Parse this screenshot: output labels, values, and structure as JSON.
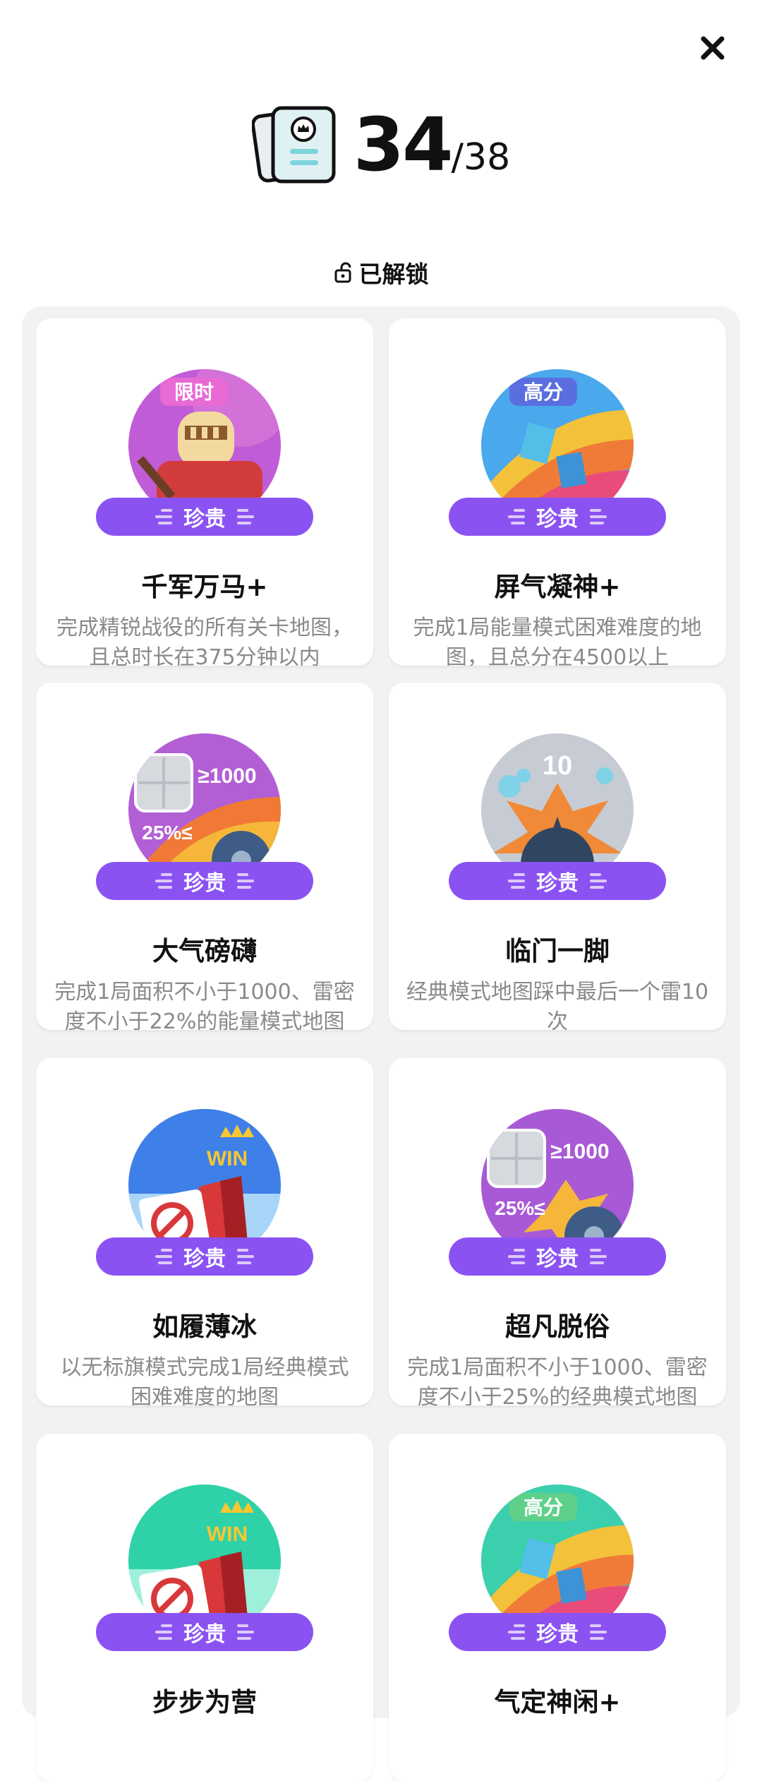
{
  "header": {
    "count": "34",
    "total": "/38"
  },
  "section": {
    "label": "已解锁"
  },
  "achievements": [
    {
      "badge_tag": "限时",
      "badge_icon": "knight-helmet-icon",
      "rarity": "珍贵",
      "title": "千军万马+",
      "desc": "完成精锐战役的所有关卡地图，且总时长在375分钟以内"
    },
    {
      "badge_tag": "高分",
      "badge_icon": "rainbow-road-icon",
      "rarity": "珍贵",
      "title": "屏气凝神+",
      "desc": "完成1局能量模式困难难度的地图，且总分在4500以上"
    },
    {
      "badge_tag": "≥1000",
      "badge_tag2": "25%≤",
      "badge_icon": "tile-mine-icon",
      "rarity": "珍贵",
      "title": "大气磅礴",
      "desc": "完成1局面积不小于1000、雷密度不小于22%的能量模式地图"
    },
    {
      "badge_tag": "10",
      "badge_icon": "mine-explosion-icon",
      "rarity": "珍贵",
      "title": "临门一脚",
      "desc": "经典模式地图踩中最后一个雷10次"
    },
    {
      "badge_tag": "WIN",
      "badge_icon": "no-flag-win-icon",
      "rarity": "珍贵",
      "title": "如履薄冰",
      "desc": "以无标旗模式完成1局经典模式困难难度的地图"
    },
    {
      "badge_tag": "≥1000",
      "badge_tag2": "25%≤",
      "badge_icon": "tile-mine-icon",
      "rarity": "珍贵",
      "title": "超凡脱俗",
      "desc": "完成1局面积不小于1000、雷密度不小于25%的经典模式地图"
    },
    {
      "badge_tag": "WIN",
      "badge_icon": "no-flag-win-icon",
      "rarity": "珍贵",
      "title": "步步为营",
      "desc": ""
    },
    {
      "badge_tag": "高分",
      "badge_icon": "rainbow-road-icon",
      "rarity": "珍贵",
      "title": "气定神闲+",
      "desc": ""
    }
  ],
  "colors": {
    "rarity_bg": "#8b52f2",
    "panel_bg": "#f2f2f5"
  }
}
